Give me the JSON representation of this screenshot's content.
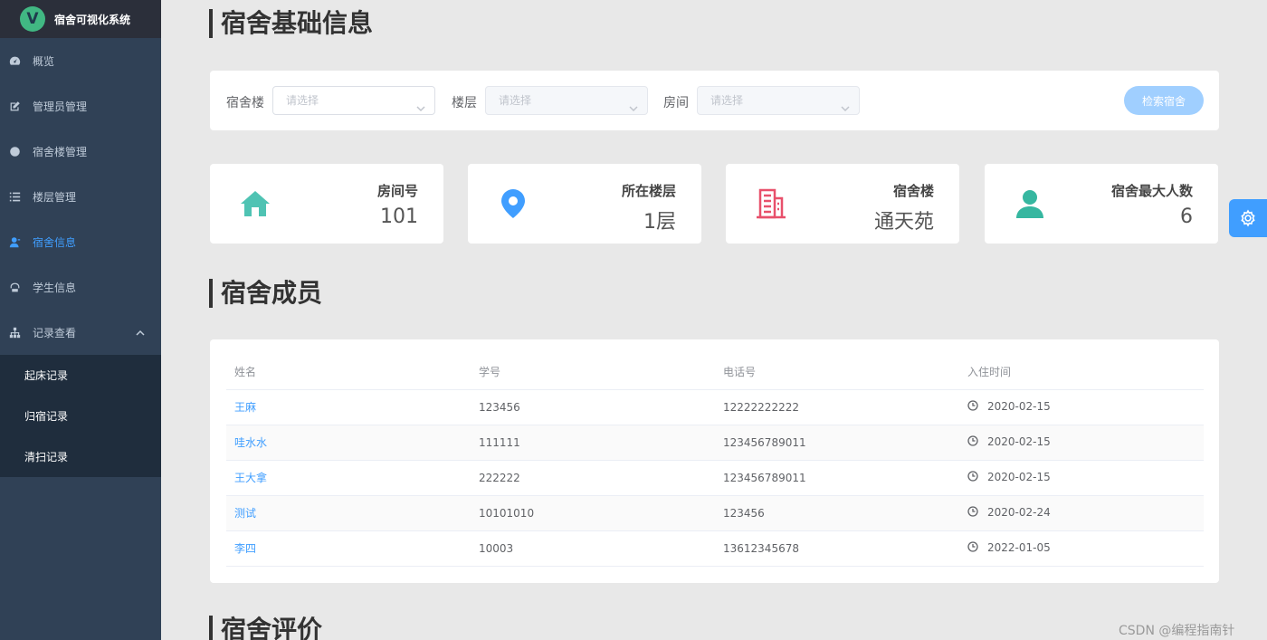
{
  "app": {
    "logo_letter": "V",
    "title": "宿舍可视化系统"
  },
  "sidebar": {
    "items": [
      {
        "label": "概览",
        "icon": "dashboard-icon"
      },
      {
        "label": "管理员管理",
        "icon": "edit-icon"
      },
      {
        "label": "宿舍楼管理",
        "icon": "globe-icon"
      },
      {
        "label": "楼层管理",
        "icon": "list-icon"
      },
      {
        "label": "宿舍信息",
        "icon": "user-icon",
        "active": true
      },
      {
        "label": "学生信息",
        "icon": "student-icon"
      },
      {
        "label": "记录查看",
        "icon": "sitemap-icon",
        "expanded": true
      }
    ],
    "submenu": [
      {
        "label": "起床记录"
      },
      {
        "label": "归宿记录"
      },
      {
        "label": "清扫记录"
      }
    ]
  },
  "sections": {
    "basic_info": "宿舍基础信息",
    "members": "宿舍成员",
    "review": "宿舍评价"
  },
  "filters": {
    "building_label": "宿舍楼",
    "floor_label": "楼层",
    "room_label": "房间",
    "placeholder": "请选择",
    "search_button": "检索宿舍"
  },
  "stats": [
    {
      "label": "房间号",
      "value": "101",
      "icon": "home-icon",
      "color": "#4fc3b3"
    },
    {
      "label": "所在楼层",
      "value": "1层",
      "icon": "location-pin-icon",
      "color": "#409eff"
    },
    {
      "label": "宿舍楼",
      "value": "通天苑",
      "icon": "building-icon",
      "color": "#e8506b"
    },
    {
      "label": "宿舍最大人数",
      "value": "6",
      "icon": "person-icon",
      "color": "#36b7a0"
    }
  ],
  "table": {
    "headers": [
      "姓名",
      "学号",
      "电话号",
      "入住时间"
    ],
    "rows": [
      {
        "name": "王麻",
        "id": "123456",
        "phone": "12222222222",
        "date": "2020-02-15"
      },
      {
        "name": "哇水水",
        "id": "111111",
        "phone": "123456789011",
        "date": "2020-02-15"
      },
      {
        "name": "王大拿",
        "id": "222222",
        "phone": "123456789011",
        "date": "2020-02-15"
      },
      {
        "name": "测试",
        "id": "10101010",
        "phone": "123456",
        "date": "2020-02-24"
      },
      {
        "name": "李四",
        "id": "10003",
        "phone": "13612345678",
        "date": "2022-01-05"
      }
    ]
  },
  "watermark": "CSDN @编程指南针"
}
